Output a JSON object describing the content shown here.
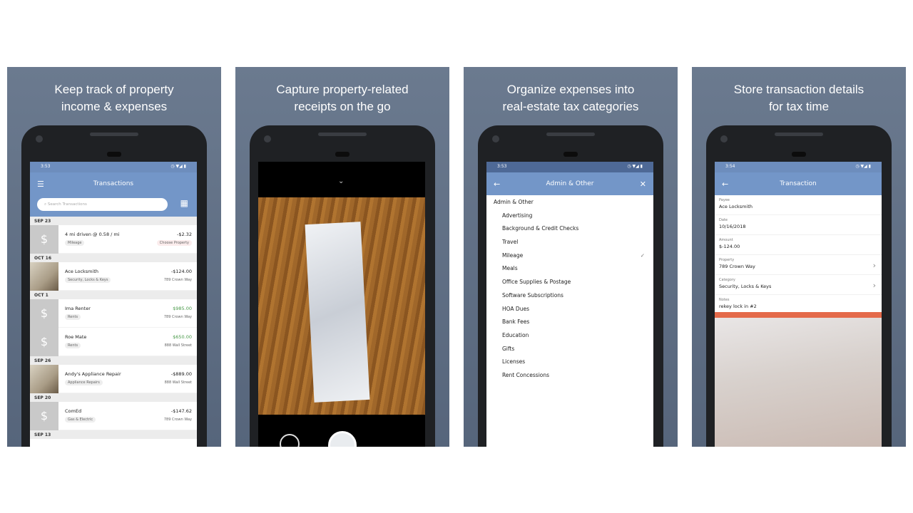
{
  "panels": [
    {
      "caption_l1": "Keep track of property",
      "caption_l2": "income & expenses"
    },
    {
      "caption_l1": "Capture property-related",
      "caption_l2": "receipts on the go"
    },
    {
      "caption_l1": "Organize expenses into",
      "caption_l2": "real-estate tax categories"
    },
    {
      "caption_l1": "Store transaction details",
      "caption_l2": "for tax time"
    }
  ],
  "transactions_screen": {
    "time": "3:53",
    "title": "Transactions",
    "search_placeholder": "Search Transactions",
    "groups": [
      {
        "date": "SEP 23",
        "items": [
          {
            "name": "4 mi driven @ 0.58 / mi",
            "tag": "Mileage",
            "amount": "-$2.32",
            "property": "Choose Property"
          }
        ]
      },
      {
        "date": "OCT 16",
        "items": [
          {
            "name": "Ace Locksmith",
            "tag": "Security, Locks & Keys",
            "amount": "-$124.00",
            "property": "789 Crown Way"
          }
        ]
      },
      {
        "date": "OCT 1",
        "items": [
          {
            "name": "Ima Renter",
            "tag": "Rents",
            "amount": "$985.00",
            "property": "789 Crown Way"
          },
          {
            "name": "Roe Mate",
            "tag": "Rents",
            "amount": "$650.00",
            "property": "888 Wall Street"
          }
        ]
      },
      {
        "date": "SEP 26",
        "items": [
          {
            "name": "Andy's Appliance Repair",
            "tag": "Appliance Repairs",
            "amount": "-$889.00",
            "property": "888 Wall Street"
          }
        ]
      },
      {
        "date": "SEP 20",
        "items": [
          {
            "name": "ComEd",
            "tag": "Gas & Electric",
            "amount": "-$147.62",
            "property": "789 Crown Way"
          }
        ]
      },
      {
        "date": "SEP 13",
        "items": []
      }
    ]
  },
  "categories_screen": {
    "time": "3:53",
    "title": "Admin & Other",
    "group": "Admin & Other",
    "selected": "Mileage",
    "items": [
      "Advertising",
      "Background & Credit Checks",
      "Travel",
      "Mileage",
      "Meals",
      "Office Supplies & Postage",
      "Software Subscriptions",
      "HOA Dues",
      "Bank Fees",
      "Education",
      "Gifts",
      "Licenses",
      "Rent Concessions"
    ]
  },
  "detail_screen": {
    "time": "3:54",
    "title": "Transaction",
    "fields": [
      {
        "label": "Payee",
        "value": "Ace Locksmith"
      },
      {
        "label": "Date",
        "value": "10/16/2018"
      },
      {
        "label": "Amount",
        "value": "$-124.00"
      },
      {
        "label": "Property",
        "value": "789 Crown Way",
        "nav": true
      },
      {
        "label": "Category",
        "value": "Security, Locks & Keys",
        "nav": true
      },
      {
        "label": "Notes",
        "value": "rekey lock in #2"
      }
    ]
  },
  "colors": {
    "accent": "#7396c8",
    "income": "#4a9a4a",
    "background": "#5f6f85"
  }
}
